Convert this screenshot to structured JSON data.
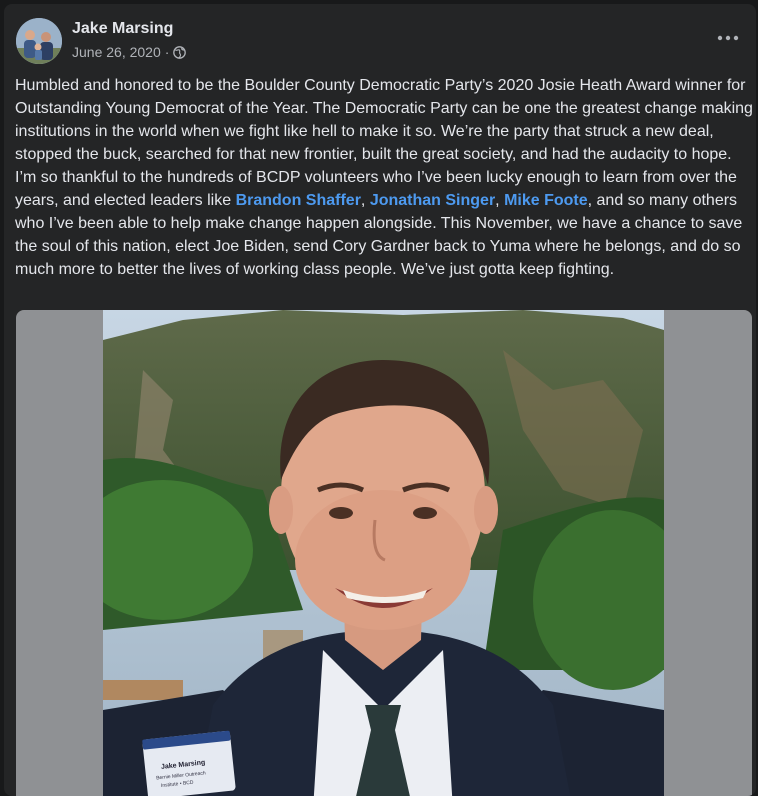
{
  "post": {
    "author": "Jake Marsing",
    "date": "June 26, 2020",
    "separator": "·",
    "privacy_icon": "globe-icon",
    "more_icon": "more-options-icon",
    "text_parts": {
      "p1": "Humbled and honored to be the Boulder County Democratic Party’s 2020 Josie Heath Award winner for Outstanding Young Democrat of the Year. The Democratic Party can be one the greatest change making institutions in the world when we fight like hell to make it so. We’re the party that struck a new deal, stopped the buck, searched for that new frontier, built the great society, and had the audacity to hope. I’m so thankful to the hundreds of BCDP volunteers who I’ve been lucky enough to learn from over the years, and elected leaders like ",
      "link1": "Brandon Shaffer",
      "sep1": ", ",
      "link2": "Jonathan Singer",
      "sep2": ", ",
      "link3": "Mike Foote",
      "p2": ", and so many others who I’ve been able to help make change happen alongside. This November, we have a chance to save the soul of this nation, elect Joe Biden, send Cory Gardner back to Yuma where he belongs, and do so much more to better the lives of working class people. We’ve just gotta keep fighting."
    },
    "photo": {
      "name_tag_line1": "Jake Marsing",
      "name_tag_line2": "Bernie Miller Outreach",
      "name_tag_line3": "Institute • BCD"
    }
  },
  "colors": {
    "card": "#242526",
    "text": "#e4e6eb",
    "meta": "#b0b3b8",
    "link": "#4d9af0"
  }
}
